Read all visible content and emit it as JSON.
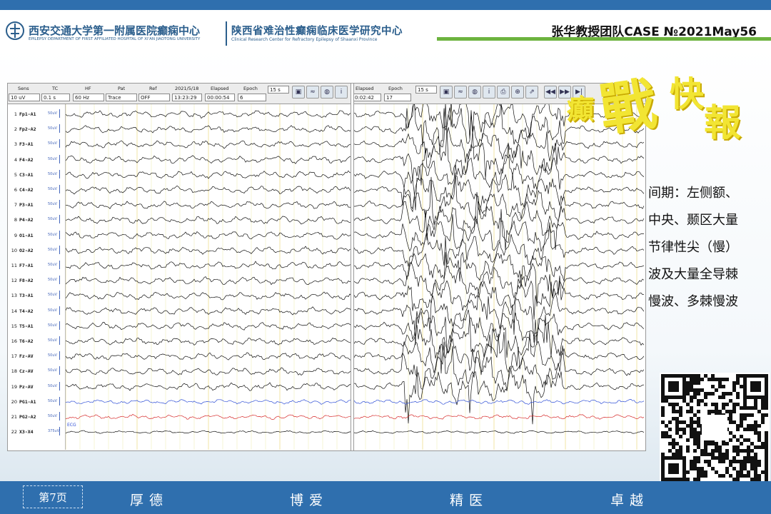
{
  "header": {
    "hospital_cn": "西安交通大学第一附属医院癫痫中心",
    "hospital_en": "EPILEPSY DEPARTMENT OF FIRST AFFILIATED HOSPITAL OF XI'AN JIAOTONG UNIVERSITY",
    "center_cn": "陕西省难治性癫痫临床医学研究中心",
    "center_en": "Clinical Research Center for Refractory Epilepsy of Shaanxi Province",
    "case_label": "张华教授团队CASE №2021May56"
  },
  "toolbar_left": {
    "sens_label": "Sens",
    "sens_value": "10 uV",
    "tc_label": "TC",
    "tc_value": "0.1 s",
    "hf_label": "HF",
    "hf_value": "60 Hz",
    "pat_label": "Pat",
    "pat_value": "Trace",
    "ref_label": "Ref",
    "ref_value": "OFF",
    "date": "2021/5/18",
    "time": "13:23:29",
    "elapsed_label": "Elapsed",
    "elapsed_value": "00:00:54",
    "epoch_label": "Epoch",
    "epoch_value": "6",
    "speed_value": "15 s"
  },
  "toolbar_right": {
    "elapsed_label": "Elapsed",
    "elapsed_value": "0:02:42",
    "epoch_label": "Epoch",
    "epoch_value": "17",
    "speed_value": "15 s"
  },
  "channels": [
    {
      "num": "1",
      "name": "Fp1-A1",
      "gain": "50uV"
    },
    {
      "num": "2",
      "name": "Fp2-A2",
      "gain": "50uV"
    },
    {
      "num": "3",
      "name": "F3-A1",
      "gain": "50uV"
    },
    {
      "num": "4",
      "name": "F4-A2",
      "gain": "50uV"
    },
    {
      "num": "5",
      "name": "C3-A1",
      "gain": "50uV"
    },
    {
      "num": "6",
      "name": "C4-A2",
      "gain": "50uV"
    },
    {
      "num": "7",
      "name": "P3-A1",
      "gain": "50uV"
    },
    {
      "num": "8",
      "name": "P4-A2",
      "gain": "50uV"
    },
    {
      "num": "9",
      "name": "O1-A1",
      "gain": "50uV"
    },
    {
      "num": "10",
      "name": "O2-A2",
      "gain": "50uV"
    },
    {
      "num": "11",
      "name": "F7-A1",
      "gain": "50uV"
    },
    {
      "num": "12",
      "name": "F8-A2",
      "gain": "50uV"
    },
    {
      "num": "13",
      "name": "T3-A1",
      "gain": "50uV"
    },
    {
      "num": "14",
      "name": "T4-A2",
      "gain": "50uV"
    },
    {
      "num": "15",
      "name": "T5-A1",
      "gain": "50uV"
    },
    {
      "num": "16",
      "name": "T6-A2",
      "gain": "50uV"
    },
    {
      "num": "17",
      "name": "Fz-AV",
      "gain": "50uV"
    },
    {
      "num": "18",
      "name": "Cz-AV",
      "gain": "50uV"
    },
    {
      "num": "19",
      "name": "Pz-AV",
      "gain": "50uV"
    },
    {
      "num": "20",
      "name": "PG1-A1",
      "gain": "50uV"
    },
    {
      "num": "21",
      "name": "PG2-A2",
      "gain": "50uV"
    },
    {
      "num": "22",
      "name": "X3-X4",
      "gain": "375uV"
    }
  ],
  "ecg_label": "ECG",
  "colors": {
    "trace": "#111111",
    "pg1": "#2f4fd6",
    "pg2": "#d62a2a",
    "grid": "#e6e08a",
    "accent": "#2f6fae",
    "green": "#6db33f"
  },
  "banner": {
    "c1": "戰",
    "c2": "癲",
    "c3": "快",
    "c4": "報"
  },
  "description": [
    "间期：左侧额、",
    "中央、颞区大量",
    "节律性尖（慢）",
    "波及大量全导棘",
    "慢波、多棘慢波"
  ],
  "footer": {
    "page": "第7页",
    "s1": "厚德",
    "s2": "博爱",
    "s3": "精医",
    "s4": "卓越"
  },
  "icons": [
    "logo-icon",
    "print-icon",
    "zoom-icon",
    "play-icon",
    "fast-forward-icon",
    "rewind-icon",
    "qr-code-icon"
  ]
}
